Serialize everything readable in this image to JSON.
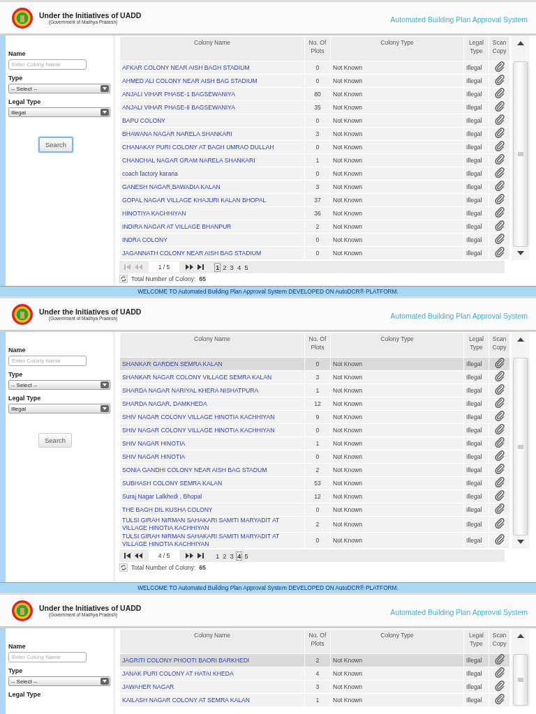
{
  "screens": [
    {
      "header": {
        "title": "Under the Initiatives of UADD",
        "subtitle": "(Government of Madhya Pradesh)",
        "system_name": "Automated Building Plan Approval System"
      },
      "filters": {
        "name_label": "Name",
        "name_placeholder": "Enter Colony Name",
        "type_label": "Type",
        "type_value": "-- Select --",
        "legal_type_label": "Legal Type",
        "legal_type_value": "Illegal",
        "search_button": {
          "label": "Search",
          "focused": true
        }
      },
      "grid": {
        "columns": [
          "Colony Name",
          "No. Of Plots",
          "Colony Type",
          "Legal Type",
          "Scan Copy"
        ],
        "rows": [
          {
            "name": "AFKAR COLONY NEAR AISH BAGH STADIUM",
            "plots": "0",
            "type": "Not Known",
            "legal": "Illegal",
            "selected": false
          },
          {
            "name": "AHMED ALI COLONY NEAR AISH BAG STADIUM",
            "plots": "0",
            "type": "Not Known",
            "legal": "Illegal",
            "selected": false
          },
          {
            "name": "ANJALI VIHAR PHASE-1 BAGSEWANIYA",
            "plots": "80",
            "type": "Not Known",
            "legal": "Illegal",
            "selected": false
          },
          {
            "name": "ANJALI VIHAR PHASE-II BAGSEWANIYA",
            "plots": "35",
            "type": "Not Known",
            "legal": "Illegal",
            "selected": false
          },
          {
            "name": "BAPU COLONY",
            "plots": "0",
            "type": "Not Known",
            "legal": "Illegal",
            "selected": false
          },
          {
            "name": "BHAWANA NAGAR NARELA SHANKARI",
            "plots": "3",
            "type": "Not Known",
            "legal": "Illegal",
            "selected": false
          },
          {
            "name": "CHANAKAY PURI COLONY AT BAGH UMRAO DULLAH",
            "plots": "0",
            "type": "Not Known",
            "legal": "Illegal",
            "selected": false
          },
          {
            "name": "CHANCHAL NAGAR GRAM NARELA SHANKARI",
            "plots": "1",
            "type": "Not Known",
            "legal": "Illegal",
            "selected": false
          },
          {
            "name": "coach factory kararia",
            "plots": "0",
            "type": "Not Known",
            "legal": "Illegal",
            "selected": false
          },
          {
            "name": "GANESH NAGAR,BAWADIA KALAN",
            "plots": "3",
            "type": "Not Known",
            "legal": "Illegal",
            "selected": false
          },
          {
            "name": "GOPAL NAGAR VILLAGE KHAJURI KALAN BHOPAL",
            "plots": "37",
            "type": "Not Known",
            "legal": "Illegal",
            "selected": false
          },
          {
            "name": "HINOTIYA KACHHIYAN",
            "plots": "36",
            "type": "Not Known",
            "legal": "Illegal",
            "selected": false
          },
          {
            "name": "INDIRA NAGAR AT VILLAGE BHANPUR",
            "plots": "2",
            "type": "Not Known",
            "legal": "Illegal",
            "selected": false
          },
          {
            "name": "INDRA COLONY",
            "plots": "0",
            "type": "Not Known",
            "legal": "Illegal",
            "selected": false
          },
          {
            "name": "JAGANNATH COLONY NEAR AISH BAG STADIUM",
            "plots": "0",
            "type": "Not Known",
            "legal": "Illegal",
            "selected": false
          }
        ],
        "pager": {
          "back_disabled": true,
          "page_field": "1 / 5",
          "pages": [
            {
              "label": "1",
              "selected": true
            },
            {
              "label": "2",
              "selected": false
            },
            {
              "label": "3",
              "selected": false
            },
            {
              "label": "4",
              "selected": false
            },
            {
              "label": "5",
              "selected": false
            }
          ]
        },
        "total_label": "Total Number of Colony:",
        "total": "65"
      },
      "welcome_bar": "WELCOME TO Automated Building Plan Approval System DEVELOPED ON AutoDCR® PLATFORM."
    },
    {
      "header": {
        "title": "Under the Initiatives of UADD",
        "subtitle": "(Government of Madhya Pradesh)",
        "system_name": "Automated Building Plan Approval System"
      },
      "filters": {
        "name_label": "Name",
        "name_placeholder": "Enter Colony Name",
        "type_label": "Type",
        "type_value": "-- Select --",
        "legal_type_label": "Legal Type",
        "legal_type_value": "Illegal",
        "search_button": {
          "label": "Search",
          "focused": false
        }
      },
      "grid": {
        "columns": [
          "Colony Name",
          "No. Of Plots",
          "Colony Type",
          "Legal Type",
          "Scan Copy"
        ],
        "rows": [
          {
            "name": "SHANKAR GARDEN SEMRA KALAN",
            "plots": "0",
            "type": "Not Known",
            "legal": "Illegal",
            "selected": true
          },
          {
            "name": "SHANKAR NAGAR COLONY VILLAGE SEMRA KALAN",
            "plots": "3",
            "type": "Not Known",
            "legal": "Illegal",
            "selected": false
          },
          {
            "name": "SHARDA NAGAR NARIYAL KHERA NISHATPURA",
            "plots": "1",
            "type": "Not Known",
            "legal": "Illegal",
            "selected": false
          },
          {
            "name": "SHARDA NAGAR, DAMKHEDA",
            "plots": "12",
            "type": "Not Known",
            "legal": "Illegal",
            "selected": false
          },
          {
            "name": "SHIV NAGAR COLONY VILLAGE HINOTIA KACHHIYAN",
            "plots": "9",
            "type": "Not Known",
            "legal": "Illegal",
            "selected": false
          },
          {
            "name": "SHIV NAGAR COLONY VILLAGE HINOTIA KACHHIYAN",
            "plots": "0",
            "type": "Not Known",
            "legal": "Illegal",
            "selected": false
          },
          {
            "name": "SHIV NAGAR HINOTIA",
            "plots": "1",
            "type": "Not Known",
            "legal": "Illegal",
            "selected": false
          },
          {
            "name": "SHIV NAGAR HINOTIA",
            "plots": "0",
            "type": "Not Known",
            "legal": "Illegal",
            "selected": false
          },
          {
            "name": "SONIA GANDHI COLONY NEAR AISH BAG STADUM",
            "plots": "2",
            "type": "Not Known",
            "legal": "Illegal",
            "selected": false
          },
          {
            "name": "SUBHASH COLONY SEMRA KALAN",
            "plots": "53",
            "type": "Not Known",
            "legal": "Illegal",
            "selected": false
          },
          {
            "name": "Suraj Nagar Lalkhedi , Bhopal",
            "plots": "12",
            "type": "Not Known",
            "legal": "Illegal",
            "selected": false
          },
          {
            "name": "THE BAGH DIL KUSHA COLONY",
            "plots": "0",
            "type": "Not Known",
            "legal": "Illegal",
            "selected": false
          },
          {
            "name": "TULSI GIRAH NIRMAN SAHAKARI SAMITI MARYADIT AT VILLAGE HINOTIA KACHHIYAN",
            "plots": "2",
            "type": "Not Known",
            "legal": "Illegal",
            "selected": false
          },
          {
            "name": "TULSI GIRAH NIRMAN SAHAKARI SAMITI MARYADIT AT VILLAGE HINOTIA KACHHIYAN",
            "plots": "0",
            "type": "Not Known",
            "legal": "Illegal",
            "selected": false
          }
        ],
        "pager": {
          "back_disabled": false,
          "page_field": "4 / 5",
          "pages": [
            {
              "label": "1",
              "selected": false
            },
            {
              "label": "2",
              "selected": false
            },
            {
              "label": "3",
              "selected": false
            },
            {
              "label": "4",
              "selected": true
            },
            {
              "label": "5",
              "selected": false
            }
          ]
        },
        "total_label": "Total Number of Colony:",
        "total": "65"
      },
      "welcome_bar": "WELCOME TO Automated Building Plan Approval System DEVELOPED ON AutoDCR® PLATFORM."
    },
    {
      "header": {
        "title": "Under the Initiatives of UADD",
        "subtitle": "(Government of Madhya Pradesh)",
        "system_name": "Automated Building Plan Approval System"
      },
      "filters": {
        "name_label": "Name",
        "name_placeholder": "Enter Colony Name",
        "type_label": "Type",
        "type_value": "-- Select --",
        "legal_type_label": "Legal Type"
      },
      "grid": {
        "columns": [
          "Colony Name",
          "No. Of Plots",
          "Colony Type",
          "Legal Type",
          "Scan Copy"
        ],
        "rows": [
          {
            "name": "JAGRITI COLONY PHOOTI BAORI BARKHEDI",
            "plots": "2",
            "type": "Not Known",
            "legal": "Illegal",
            "selected": true
          },
          {
            "name": "JANAK PURI COLONY AT HATAI KHEDA",
            "plots": "4",
            "type": "Not Known",
            "legal": "Illegal",
            "selected": false
          },
          {
            "name": "JAWAHER NAGAR",
            "plots": "3",
            "type": "Not Known",
            "legal": "Illegal",
            "selected": false
          },
          {
            "name": "KAILASH NAGAR COLONY AT SEMRA KALAN",
            "plots": "1",
            "type": "Not Known",
            "legal": "Illegal",
            "selected": false
          }
        ]
      }
    }
  ]
}
